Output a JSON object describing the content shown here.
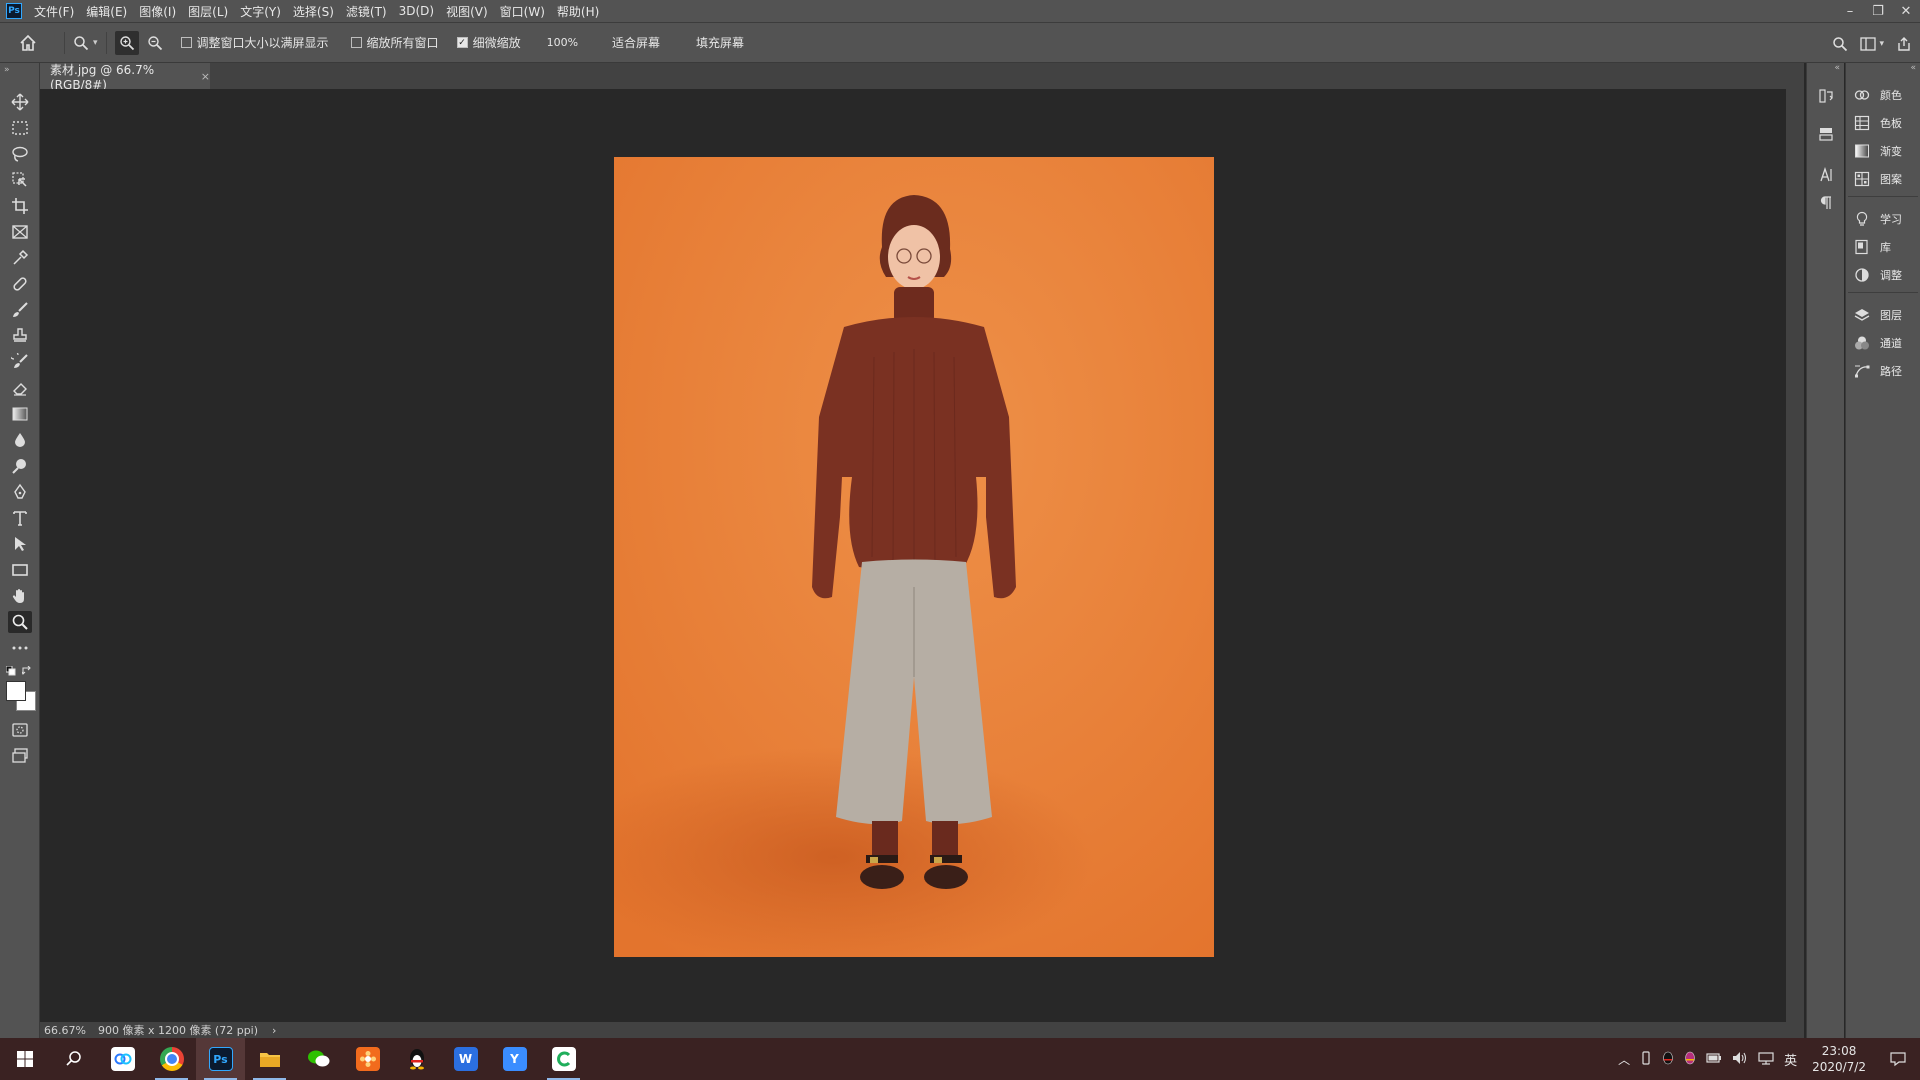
{
  "menubar": {
    "logo": "Ps",
    "menus": [
      "文件(F)",
      "编辑(E)",
      "图像(I)",
      "图层(L)",
      "文字(Y)",
      "选择(S)",
      "滤镜(T)",
      "3D(D)",
      "视图(V)",
      "窗口(W)",
      "帮助(H)"
    ],
    "window_controls": [
      "–",
      "❐",
      "✕"
    ]
  },
  "options": {
    "resize_windows_label": "调整窗口大小以满屏显示",
    "resize_windows_checked": false,
    "zoom_all_label": "缩放所有窗口",
    "zoom_all_checked": false,
    "scrubby_zoom_label": "细微缩放",
    "scrubby_zoom_checked": true,
    "zoom_100_label": "100%",
    "fit_screen_label": "适合屏幕",
    "fill_screen_label": "填充屏幕"
  },
  "document": {
    "tab_title": "素材.jpg @ 66.7%(RGB/8#)",
    "close_glyph": "×",
    "background_color": "#ea8338"
  },
  "status": {
    "zoom": "66.67%",
    "doc_info": "900 像素 x 1200 像素 (72 ppi)",
    "arrow": "›"
  },
  "panels": {
    "items": [
      {
        "icon": "color-icon",
        "label": "颜色"
      },
      {
        "icon": "swatches-icon",
        "label": "色板"
      },
      {
        "icon": "gradient-icon",
        "label": "渐变"
      },
      {
        "icon": "pattern-icon",
        "label": "图案"
      },
      {
        "icon": "learn-icon",
        "label": "学习"
      },
      {
        "icon": "library-icon",
        "label": "库"
      },
      {
        "icon": "adjustments-icon",
        "label": "调整"
      },
      {
        "icon": "layers-icon",
        "label": "图层"
      },
      {
        "icon": "channels-icon",
        "label": "通道"
      },
      {
        "icon": "paths-icon",
        "label": "路径"
      }
    ]
  },
  "taskbar": {
    "ime": "英",
    "time": "23:08",
    "date": "2020/7/2"
  }
}
